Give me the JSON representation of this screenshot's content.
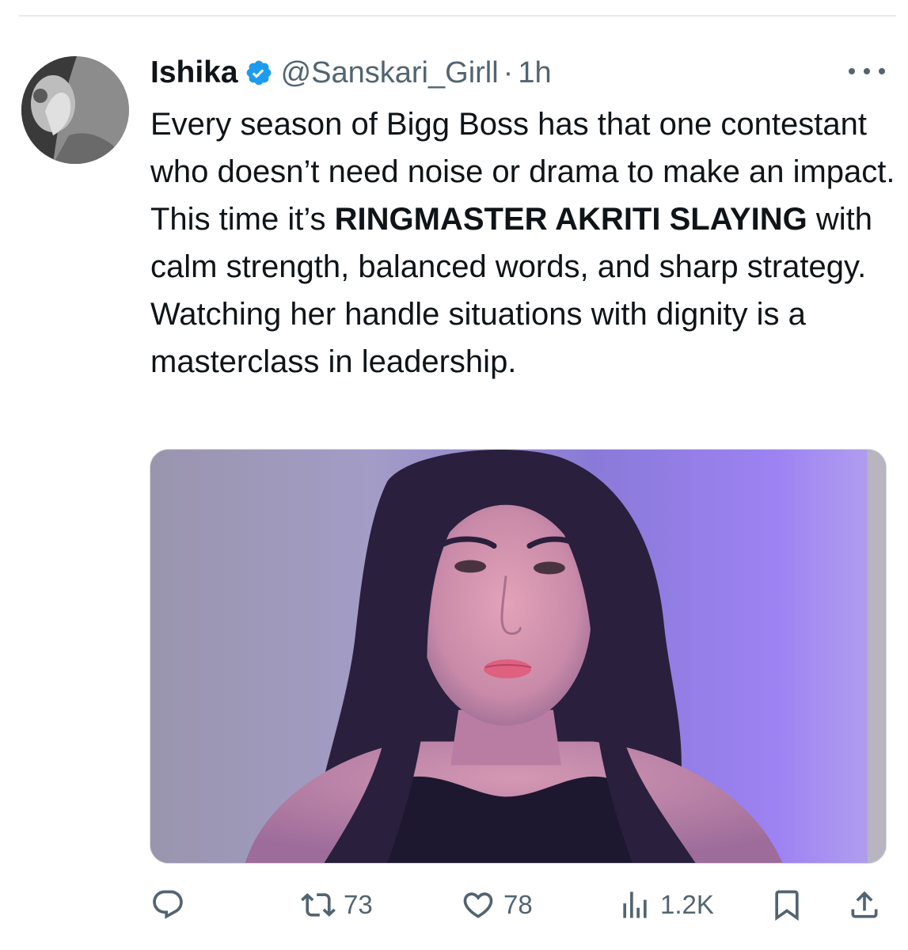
{
  "tweet": {
    "display_name": "Ishika",
    "handle": "@Sanskari_Girll",
    "separator": "·",
    "time": "1h",
    "verified_icon": "verified-badge-icon",
    "more_icon": "more-horizontal-icon",
    "text": {
      "part1": "Every season of Bigg Boss has that one contestant who doesn’t need noise or drama to make an impact. This time it’s ",
      "bold": "RINGMASTER AKRITI SLAYING",
      "part2": " with calm strength, balanced words, and sharp strategy. Watching her handle situations with dignity is a masterclass in leadership."
    },
    "media": {
      "type": "photo",
      "description_icon": "photo-woman-portrait"
    }
  },
  "actions": {
    "reply": {
      "icon": "reply-icon",
      "count": ""
    },
    "retweet": {
      "icon": "retweet-icon",
      "count": "73"
    },
    "like": {
      "icon": "heart-icon",
      "count": "78"
    },
    "views": {
      "icon": "views-chart-icon",
      "count": "1.2K"
    },
    "bookmark": {
      "icon": "bookmark-icon"
    },
    "share": {
      "icon": "share-icon"
    }
  },
  "colors": {
    "text_primary": "#0f1419",
    "text_secondary": "#536471",
    "verified_blue": "#1d9bf0",
    "divider": "#e7e9ea"
  }
}
